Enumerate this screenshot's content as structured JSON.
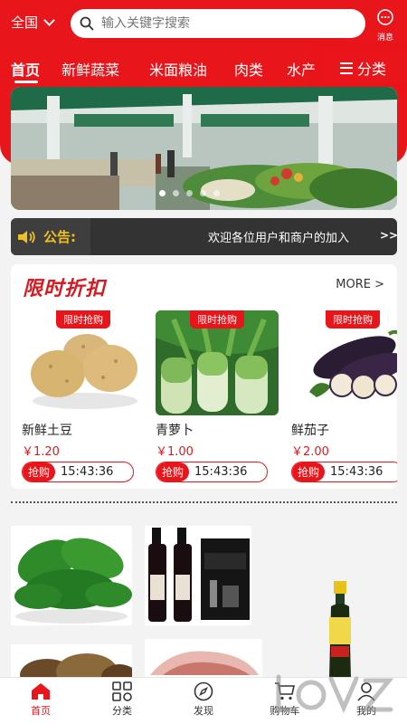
{
  "header": {
    "city": "全国",
    "search_placeholder": "输入关键字搜索",
    "message_label": "消息"
  },
  "tabs": [
    {
      "label": "首页",
      "active": true
    },
    {
      "label": "新鲜蔬菜",
      "active": false
    },
    {
      "label": "米面粮油",
      "active": false
    },
    {
      "label": "肉类",
      "active": false
    },
    {
      "label": "水产",
      "active": false
    }
  ],
  "category_button": "分类",
  "notice": {
    "label": "公告:",
    "text": "欢迎各位用户和商户的加入",
    "more": ">>"
  },
  "flash_sale": {
    "title": "限时折扣",
    "more": "MORE >",
    "items": [
      {
        "tag": "限时抢购",
        "name": "新鲜土豆",
        "price": "￥1.20",
        "buy": "抢购",
        "countdown": "15:43:36"
      },
      {
        "tag": "限时抢购",
        "name": "青萝卜",
        "price": "￥1.00",
        "buy": "抢购",
        "countdown": "15:43:36"
      },
      {
        "tag": "限时抢购",
        "name": "鲜茄子",
        "price": "￥2.00",
        "buy": "抢购",
        "countdown": "15:43:36"
      }
    ]
  },
  "bottom_nav": [
    {
      "label": "首页",
      "icon": "home-icon",
      "active": true
    },
    {
      "label": "分类",
      "icon": "grid-icon",
      "active": false
    },
    {
      "label": "发现",
      "icon": "compass-icon",
      "active": false
    },
    {
      "label": "购物车",
      "icon": "cart-icon",
      "active": false
    },
    {
      "label": "我的",
      "icon": "user-icon",
      "active": false
    }
  ],
  "colors": {
    "brand": "#e8151b",
    "notice_bg": "#333333",
    "notice_label": "#f0c020"
  }
}
